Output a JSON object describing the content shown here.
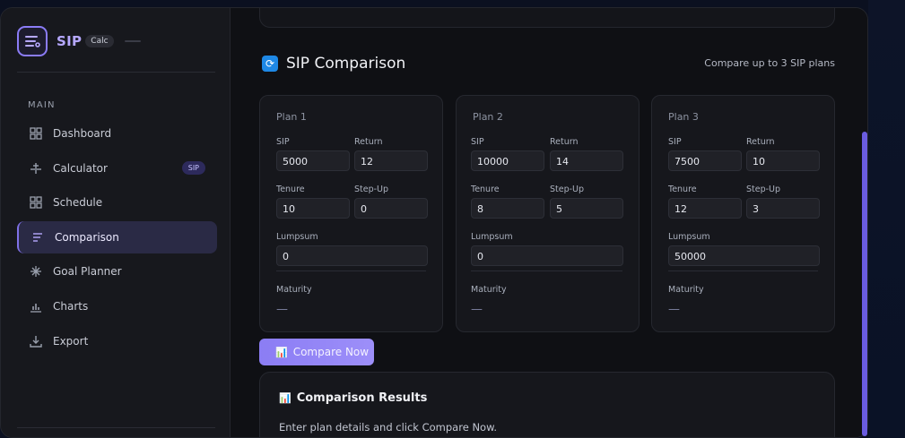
{
  "brand": {
    "title": "SIP",
    "badge": "Calc",
    "logo_icon": "list-icon"
  },
  "sidebar": {
    "section_label": "MAIN",
    "items": [
      {
        "label": "Dashboard",
        "icon": "grid-icon"
      },
      {
        "label": "Calculator",
        "icon": "plus-minus-icon",
        "badge": "SIP"
      },
      {
        "label": "Schedule",
        "icon": "grid-icon"
      },
      {
        "label": "Comparison",
        "icon": "lines-icon",
        "active": true
      },
      {
        "label": "Goal Planner",
        "icon": "sparkle-icon"
      },
      {
        "label": "Charts",
        "icon": "bar-chart-icon"
      },
      {
        "label": "Export",
        "icon": "download-icon"
      }
    ]
  },
  "section": {
    "title": "SIP Comparison",
    "emoji": "🔄",
    "subtitle": "Compare up to 3 SIP plans"
  },
  "labels": {
    "sip": "SIP",
    "return": "Return",
    "tenure": "Tenure",
    "stepup": "Step-Up",
    "lumpsum": "Lumpsum",
    "maturity": "Maturity"
  },
  "plans": [
    {
      "title": "Plan 1",
      "sip": "5000",
      "return": "12",
      "tenure": "10",
      "stepup": "0",
      "lumpsum": "0",
      "maturity": "—"
    },
    {
      "title": "Plan 2",
      "sip": "10000",
      "return": "14",
      "tenure": "8",
      "stepup": "5",
      "lumpsum": "0",
      "maturity": "—"
    },
    {
      "title": "Plan 3",
      "sip": "7500",
      "return": "10",
      "tenure": "12",
      "stepup": "3",
      "lumpsum": "50000",
      "maturity": "—"
    }
  ],
  "compare_button": {
    "label": "Compare Now",
    "emoji": "📊"
  },
  "results": {
    "title": "Comparison Results",
    "emoji": "📊",
    "message": "Enter plan details and click Compare Now."
  },
  "colors": {
    "accent": "#8b7df4",
    "active_bg": "#2a2a45",
    "brand": "#b6a8ff"
  }
}
